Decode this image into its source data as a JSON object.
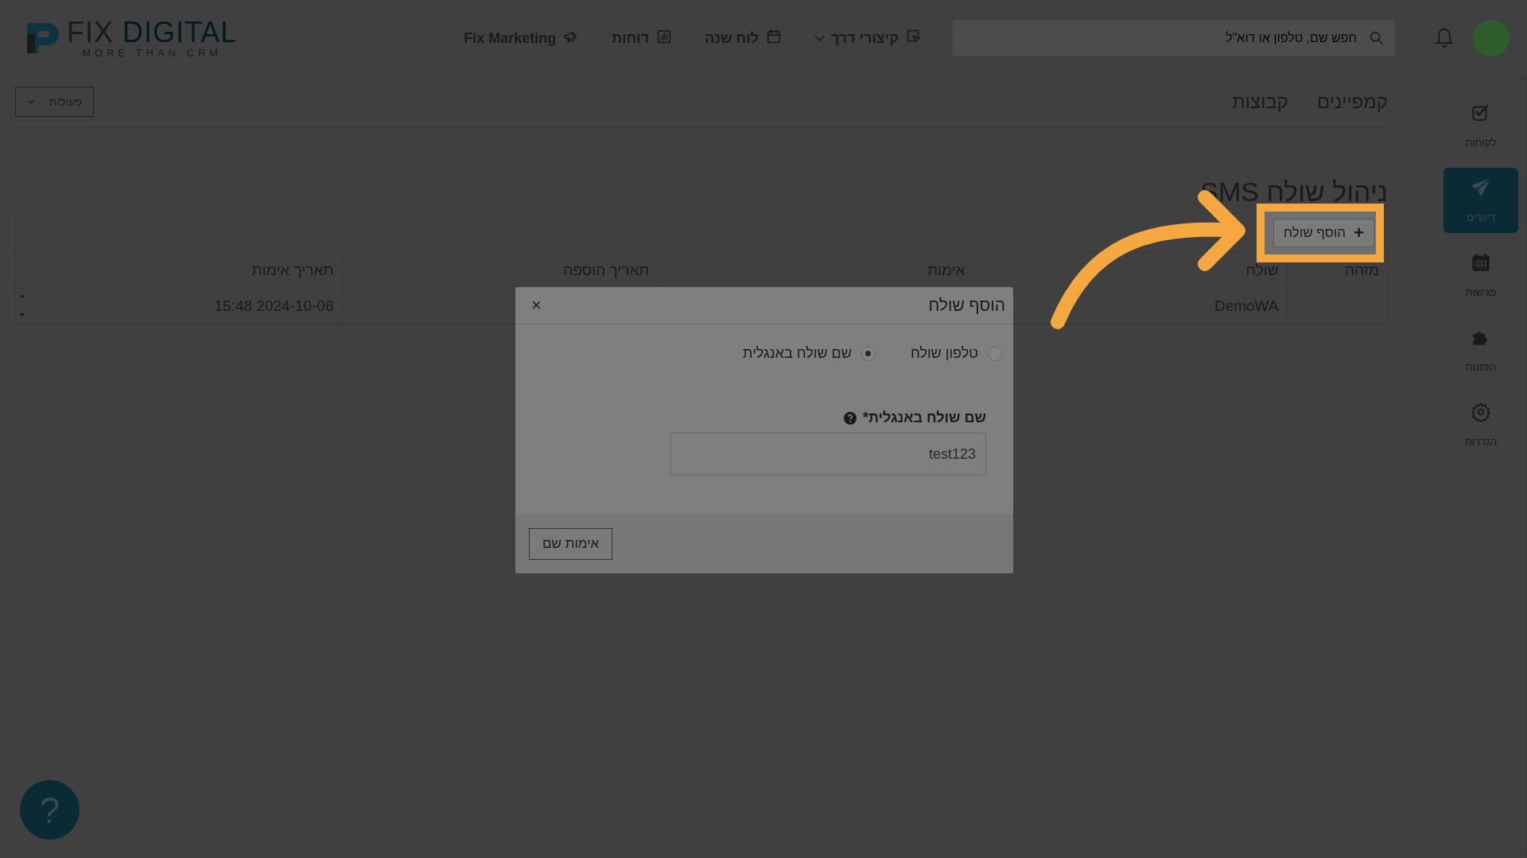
{
  "header": {
    "logo": {
      "first": "FIX",
      "second": "DIGITAL",
      "tagline": "MORE THAN CRM"
    },
    "nav": [
      {
        "label": "קיצורי דרך",
        "dropdown": true
      },
      {
        "label": "לוח שנה",
        "dropdown": false
      },
      {
        "label": "דוחות",
        "dropdown": false
      },
      {
        "label": "Fix Marketing",
        "dropdown": false
      }
    ],
    "search": {
      "placeholder": "חפש שם, טלפון או דוא\"ל"
    }
  },
  "sidebar": {
    "items": [
      {
        "label": "לקוחות",
        "selected": false
      },
      {
        "label": "דיוורים",
        "selected": true
      },
      {
        "label": "פגישות",
        "selected": false
      },
      {
        "label": "הזמנות",
        "selected": false
      },
      {
        "label": "הגדרות",
        "selected": false
      }
    ]
  },
  "tabs": [
    {
      "label": "קמפיינים"
    },
    {
      "label": "קבוצות"
    }
  ],
  "actions_button": "פעולות",
  "page_title": "ניהול שולח SMS",
  "add_button": {
    "icon": "+",
    "label": "הוסף שולח",
    "highlighted": true
  },
  "table": {
    "columns": [
      "מזהה",
      "שולח",
      "אימות",
      "תאריך הוספה",
      "תאריך אימות"
    ],
    "rows": [
      [
        "",
        "DemoWA",
        "",
        "",
        "15:48 2024-10-06"
      ]
    ]
  },
  "modal": {
    "title": "הוסף שולח",
    "close": "×",
    "options": [
      {
        "label": "טלפון שולח",
        "selected": false
      },
      {
        "label": "שם שולח באנגלית",
        "selected": true
      }
    ],
    "field": {
      "label": "שם שולח באנגלית*",
      "value": "test123"
    },
    "button": "אימות שם"
  },
  "help_button": "?"
}
